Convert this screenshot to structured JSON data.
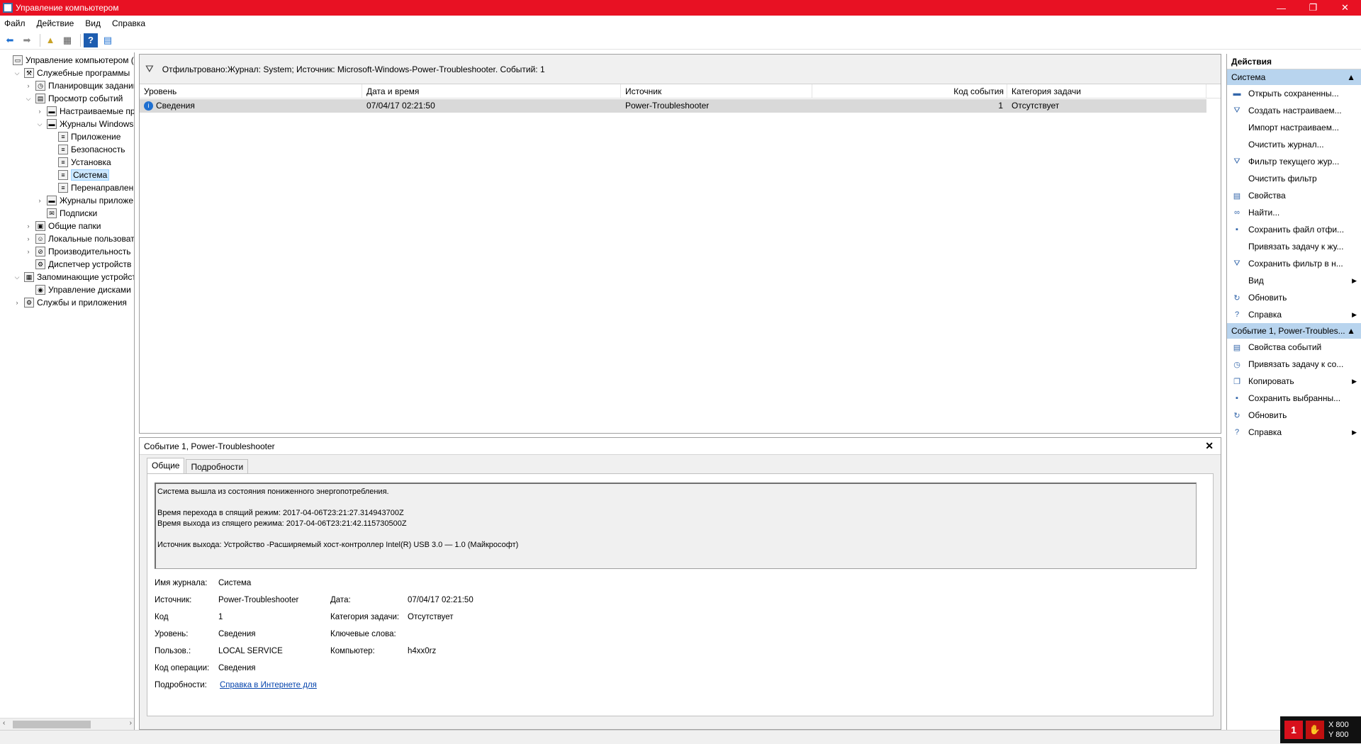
{
  "window": {
    "title": "Управление компьютером",
    "btn_min": "—",
    "btn_restore": "❐",
    "btn_close": "✕"
  },
  "menu": [
    "Файл",
    "Действие",
    "Вид",
    "Справка"
  ],
  "tree": [
    {
      "label": "Управление компьютером (л",
      "toggle": "",
      "icon": "computer-icon",
      "level": 0
    },
    {
      "label": "Служебные программы",
      "toggle": "⌵",
      "icon": "tools-icon",
      "level": 1
    },
    {
      "label": "Планировщик заданий",
      "toggle": "›",
      "icon": "clock-icon",
      "level": 2
    },
    {
      "label": "Просмотр событий",
      "toggle": "⌵",
      "icon": "event-viewer-icon",
      "level": 2
    },
    {
      "label": "Настраиваемые пр",
      "toggle": "›",
      "icon": "folder-icon",
      "level": 3
    },
    {
      "label": "Журналы Windows",
      "toggle": "⌵",
      "icon": "folder-icon",
      "level": 3
    },
    {
      "label": "Приложение",
      "toggle": "",
      "icon": "log-icon",
      "level": 4
    },
    {
      "label": "Безопасность",
      "toggle": "",
      "icon": "log-icon",
      "level": 4
    },
    {
      "label": "Установка",
      "toggle": "",
      "icon": "log-icon",
      "level": 4
    },
    {
      "label": "Система",
      "toggle": "",
      "icon": "log-icon",
      "level": 4,
      "selected": true
    },
    {
      "label": "Перенаправлен",
      "toggle": "",
      "icon": "log-icon",
      "level": 4
    },
    {
      "label": "Журналы приложе",
      "toggle": "›",
      "icon": "folder-icon",
      "level": 3
    },
    {
      "label": "Подписки",
      "toggle": "",
      "icon": "subscriptions-icon",
      "level": 3
    },
    {
      "label": "Общие папки",
      "toggle": "›",
      "icon": "shared-folders-icon",
      "level": 2
    },
    {
      "label": "Локальные пользовате",
      "toggle": "›",
      "icon": "users-icon",
      "level": 2
    },
    {
      "label": "Производительность",
      "toggle": "›",
      "icon": "performance-icon",
      "level": 2
    },
    {
      "label": "Диспетчер устройств",
      "toggle": "",
      "icon": "device-manager-icon",
      "level": 2
    },
    {
      "label": "Запоминающие устройст",
      "toggle": "⌵",
      "icon": "storage-icon",
      "level": 1
    },
    {
      "label": "Управление дисками",
      "toggle": "",
      "icon": "disk-icon",
      "level": 2
    },
    {
      "label": "Службы и приложения",
      "toggle": "›",
      "icon": "services-icon",
      "level": 1
    }
  ],
  "filter_text": "Отфильтровано:Журнал: System; Источник: Microsoft-Windows-Power-Troubleshooter. Событий: 1",
  "grid": {
    "headers": [
      "Уровень",
      "Дата и время",
      "Источник",
      "Код события",
      "Категория задачи"
    ],
    "rows": [
      {
        "level": "Сведения",
        "datetime": "07/04/17 02:21:50",
        "source": "Power-Troubleshooter",
        "code": "1",
        "category": "Отсутствует"
      }
    ]
  },
  "detail": {
    "header": "Событие 1, Power-Troubleshooter",
    "tabs": [
      "Общие",
      "Подробности"
    ],
    "message": "Система вышла из состояния пониженного энергопотребления.\n\nВремя перехода в спящий режим: 2017-04-06T23:21:27.314943700Z\nВремя выхода из спящего режима: 2017-04-06T23:21:42.115730500Z\n\nИсточник выхода: Устройство -Расширяемый хост-контроллер Intel(R) USB 3.0 — 1.0 (Майкрософт)",
    "fields": {
      "log_name_label": "Имя журнала:",
      "log_name": "Система",
      "source_label": "Источник:",
      "source": "Power-Troubleshooter",
      "date_label": "Дата:",
      "date": "07/04/17 02:21:50",
      "code_label": "Код",
      "code": "1",
      "category_label": "Категория задачи:",
      "category": "Отсутствует",
      "level_label": "Уровень:",
      "level": "Сведения",
      "keywords_label": "Ключевые слова:",
      "user_label": "Пользов.:",
      "user": "LOCAL SERVICE",
      "computer_label": "Компьютер:",
      "computer": "h4xx0rz",
      "opcode_label": "Код операции:",
      "opcode": "Сведения",
      "details_label": "Подробности:",
      "details_link": "Справка в Интернете для"
    }
  },
  "actions": {
    "title": "Действия",
    "section1": "Система",
    "items1": [
      {
        "label": "Открыть сохраненны...",
        "icon": "open-icon",
        "arrow": false
      },
      {
        "label": "Создать настраиваем...",
        "icon": "filter-create-icon",
        "arrow": false
      },
      {
        "label": "Импорт настраиваем...",
        "icon": "",
        "arrow": false
      },
      {
        "label": "Очистить журнал...",
        "icon": "",
        "arrow": false
      },
      {
        "label": "Фильтр текущего жур...",
        "icon": "filter-icon",
        "arrow": false
      },
      {
        "label": "Очистить фильтр",
        "icon": "",
        "arrow": false
      },
      {
        "label": "Свойства",
        "icon": "properties-icon",
        "arrow": false
      },
      {
        "label": "Найти...",
        "icon": "binoculars-icon",
        "arrow": false
      },
      {
        "label": "Сохранить файл отфи...",
        "icon": "save-icon",
        "arrow": false
      },
      {
        "label": "Привязать задачу к жу...",
        "icon": "",
        "arrow": false
      },
      {
        "label": "Сохранить фильтр в н...",
        "icon": "save-filter-icon",
        "arrow": false
      },
      {
        "label": "Вид",
        "icon": "",
        "arrow": true
      },
      {
        "label": "Обновить",
        "icon": "refresh-icon",
        "arrow": false
      },
      {
        "label": "Справка",
        "icon": "help-icon",
        "arrow": true
      }
    ],
    "section2": "Событие 1, Power-Troubles...",
    "items2": [
      {
        "label": "Свойства событий",
        "icon": "event-properties-icon",
        "arrow": false
      },
      {
        "label": "Привязать задачу к со...",
        "icon": "attach-task-icon",
        "arrow": false
      },
      {
        "label": "Копировать",
        "icon": "copy-icon",
        "arrow": true
      },
      {
        "label": "Сохранить выбранны...",
        "icon": "save-icon",
        "arrow": false
      },
      {
        "label": "Обновить",
        "icon": "refresh-icon",
        "arrow": false
      },
      {
        "label": "Справка",
        "icon": "help-icon",
        "arrow": true
      }
    ]
  },
  "overlay": {
    "badge": "1",
    "x_label": "X 800",
    "y_label": "Y 800"
  }
}
